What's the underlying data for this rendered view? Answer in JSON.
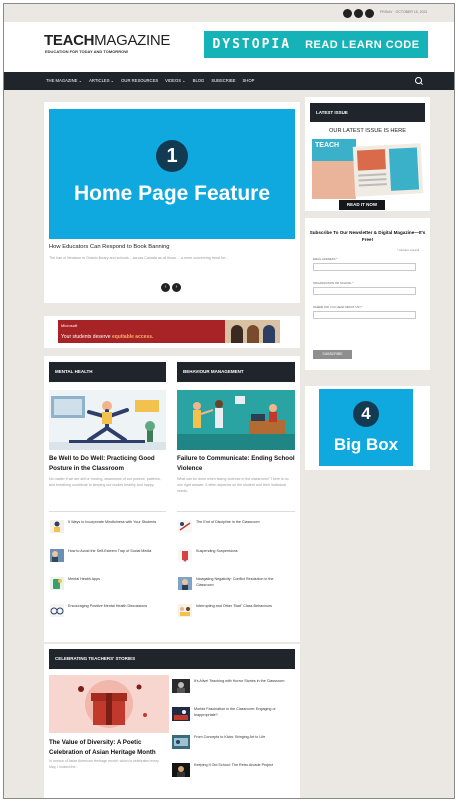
{
  "topbar": {
    "social_icons": [
      "facebook-icon",
      "twitter-icon",
      "instagram-icon"
    ],
    "date": "FRIDAY · OCTOBER 15, 2021"
  },
  "header": {
    "logo_bold": "TEACH",
    "logo_light": "MAGAZINE",
    "tagline": "EDUCATION FOR TODAY AND TOMORROW",
    "ad_left": "DYSTOPIA",
    "ad_right": "READ LEARN CODE",
    "ad_color": "#15b3b8"
  },
  "nav": {
    "items": [
      "THE MAGAZINE ⌄",
      "ARTICLES ⌄",
      "OUR RESOURCES",
      "VIDEOS ⌄",
      "BLOG",
      "SUBSCRIBE",
      "SHOP"
    ],
    "search_icon": "search-icon",
    "background": "#1f252b"
  },
  "feature": {
    "placeholder_number": "1",
    "placeholder_label": "Home Page Feature",
    "placeholder_color": "#0fa9e0",
    "headline": "How Educators Can Respond to Book Banning",
    "excerpt": "The ban of literature in Ontario library and schools... across Canada as all those ... a more concerning trend for...",
    "slider_prev": "‹",
    "slider_next": "›"
  },
  "ad_banner": {
    "brand": "Microsoft",
    "message_start": "Your students deserve ",
    "message_highlight": "equitable access."
  },
  "mental_health": {
    "section_label": "MENTAL HEALTH",
    "main_title": "Be Well to Do Well: Practicing Good Posture in the Classroom",
    "main_excerpt": "No matter if we are still or moving, awareness of our posture, patterns, and breathing contribute to keeping our bodies healthy and happy.",
    "items": [
      "5 Ways to Incorporate Mindfulness with Your Students",
      "How to Avoid the Self-Esteem Trap of Social Media",
      "Mental Health Apps",
      "Encouraging Positive Mental Health Discussions"
    ]
  },
  "behaviour": {
    "section_label": "BEHAVIOUR MANAGEMENT",
    "main_title": "Failure to Communicate: Ending School Violence",
    "main_excerpt": "What can be done when facing violence in the classroom? There is no one right answer. It often depends on the student and their individual needs.",
    "items": [
      "The End of Discipline in the Classroom",
      "Suspending Suspensions",
      "Navigating Negativity: Conflict Resolution in the Classroom",
      "Interrupting and Other \"Bad\" Class Behaviours"
    ]
  },
  "celebrating": {
    "section_label": "CELEBRATING TEACHERS' STORIES",
    "main_title": "The Value of Diversity: A Poetic Celebration of Asian Heritage Month",
    "main_excerpt": "In honour of Asian American Heritage month, which is celebrated every May, I looked the...",
    "items": [
      "It's Alive! Teaching with Horror Stories in the Classroom",
      "Morbid Fascination in the Classroom: Engaging or Inappropriate?",
      "From Concepts to Kicks: Bringing Art to Life",
      "Keeping It Old School: The Retro Arcade Project"
    ]
  },
  "latest_issue": {
    "header": "LATEST ISSUE",
    "subheading": "OUR LATEST ISSUE IS HERE",
    "cover_title": "TEACH",
    "button": "READ IT NOW"
  },
  "newsletter": {
    "title": "Subscribe To Our Newsletter & Digital Magazine—It's Free!",
    "required_note": "* indicates required",
    "fields": [
      "EMAIL ADDRESS *",
      "ORGANIZATION OR SCHOOL *",
      "WHERE DID YOU HEAR ABOUT US? *"
    ],
    "button": "SUBSCRIBE"
  },
  "big_box": {
    "placeholder_number": "4",
    "placeholder_label": "Big Box",
    "color": "#0fa9e0"
  }
}
